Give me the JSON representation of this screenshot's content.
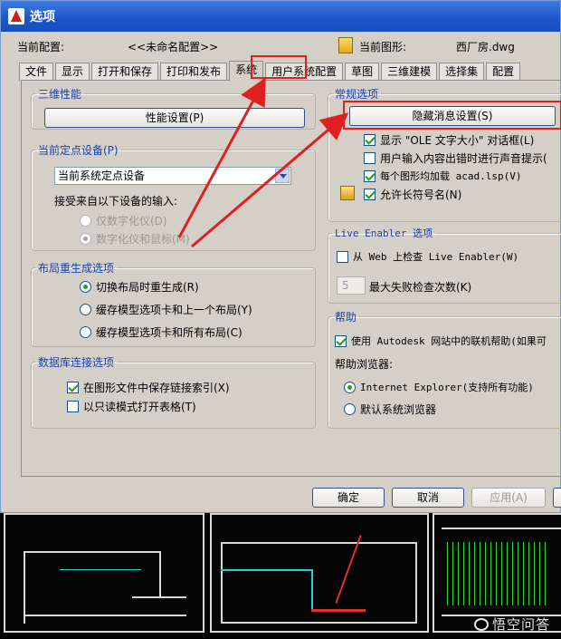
{
  "window": {
    "title": "选项"
  },
  "profile": {
    "label": "当前配置:",
    "value": "<<未命名配置>>",
    "drawing_label": "当前图形:",
    "drawing_value": "西厂房.dwg"
  },
  "tabs": [
    {
      "label": "文件"
    },
    {
      "label": "显示"
    },
    {
      "label": "打开和保存"
    },
    {
      "label": "打印和发布"
    },
    {
      "label": "系统",
      "active": true
    },
    {
      "label": "用户系统配置"
    },
    {
      "label": "草图"
    },
    {
      "label": "三维建模"
    },
    {
      "label": "选择集"
    },
    {
      "label": "配置"
    }
  ],
  "performance": {
    "title": "三维性能",
    "button": "性能设置(P)"
  },
  "pointing": {
    "title": "当前定点设备(P)",
    "select_value": "当前系统定点设备",
    "accept_label": "接受来自以下设备的输入:",
    "opt_digitizer": "仅数字化仪(D)",
    "opt_both": "数字化仪和鼠标(M)"
  },
  "layout_regen": {
    "title": "布局重生成选项",
    "opt1": "切换布局时重生成(R)",
    "opt2": "缓存模型选项卡和上一个布局(Y)",
    "opt3": "缓存模型选项卡和所有布局(C)"
  },
  "db_connect": {
    "title": "数据库连接选项",
    "opt1": "在图形文件中保存链接索引(X)",
    "opt2": "以只读模式打开表格(T)"
  },
  "general": {
    "title": "常规选项",
    "hidden_btn": "隐藏消息设置(S)",
    "opt1": "显示 \"OLE 文字大小\" 对话框(L)",
    "opt2": "用户输入内容出错时进行声音提示(",
    "opt3": "每个图形均加载 acad.lsp(V)",
    "opt4": "允许长符号名(N)"
  },
  "live_enabler": {
    "title": "Live Enabler 选项",
    "opt1": "从 Web 上检查 Live Enabler(W)",
    "num_value": "5",
    "num_label": "最大失败检查次数(K)"
  },
  "help": {
    "title": "帮助",
    "opt1": "使用 Autodesk 网站中的联机帮助(如果可",
    "browser_label": "帮助浏览器:",
    "opt_ie": "Internet Explorer(支持所有功能)",
    "opt_default": "默认系统浏览器"
  },
  "buttons": {
    "ok": "确定",
    "cancel": "取消",
    "apply": "应用(A)"
  },
  "watermark": "悟空问答",
  "colors": {
    "annotation": "#e02020",
    "titlebar": "#1b55c9"
  }
}
